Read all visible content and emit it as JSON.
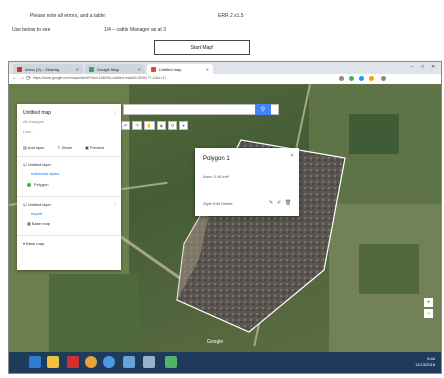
{
  "document": {
    "line1": "Please note all errors, and a table:",
    "line1_right": "ERR 2 x1.5",
    "line2_left": "Use below to see",
    "line2_mid": "1/4 – cattle Manager as at 3",
    "button_label": "Start Map!"
  },
  "browser": {
    "tabs": [
      {
        "label": "Inbox (3) – Sharing",
        "color": "#d93025"
      },
      {
        "label": "Google Map",
        "color": "#34a853"
      },
      {
        "label": "Untitled map",
        "color": "#ea4335"
      }
    ],
    "url": "https://www.google.com/maps/d/edit?mid=1s5DHo-untitled-map&ll=28.69,77.12&z=17"
  },
  "map_ui": {
    "search_placeholder": "",
    "search_icon": "search-icon",
    "tools": [
      "↶",
      "↷",
      "✋",
      "◈",
      "☷",
      "⌖"
    ],
    "sidebar": {
      "title": "Untitled map",
      "subtitle": "All changes",
      "description": "Last...",
      "actions": [
        "Add layer",
        "Share",
        "Preview"
      ],
      "layer_title": "Untitled layer",
      "layer_style": "Individual styles",
      "layer_item": "Polygon",
      "layer2_title": "Untitled layer",
      "layer2_link": "Import",
      "layer2_item": "Base map",
      "base_map": "Base map"
    },
    "popup": {
      "title": "Polygon 1",
      "subtitle": "Area: 0.48 km²",
      "footer": "Style  Edit  Delete"
    },
    "attribution": "Google"
  },
  "taskbar": {
    "icons": [
      {
        "name": "windows-start-icon",
        "color": "#2d7dd2"
      },
      {
        "name": "file-explorer-icon",
        "color": "#f0c040"
      },
      {
        "name": "pdf-reader-icon",
        "color": "#d32f2f"
      },
      {
        "name": "chrome-icon",
        "color": "#e8a23a"
      },
      {
        "name": "firefox-icon",
        "color": "#4c9be8"
      },
      {
        "name": "media-icon",
        "color": "#6aa0d8"
      },
      {
        "name": "network-icon",
        "color": "#9ab0c8"
      },
      {
        "name": "paint-icon",
        "color": "#4fb36a"
      }
    ],
    "time": "5:46",
    "date": "11/13/2018"
  }
}
